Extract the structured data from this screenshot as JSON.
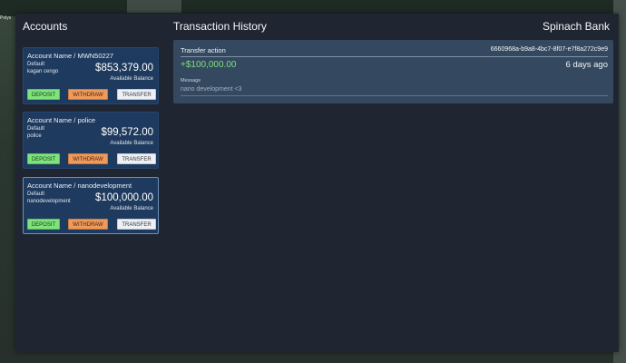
{
  "background": {
    "world_label": "Polys"
  },
  "header": {
    "accounts_title": "Accounts",
    "history_title": "Transaction History",
    "bank_name": "Spinach Bank"
  },
  "accounts": [
    {
      "name": "Account Name / MWN50227",
      "type": "Default",
      "owner": "kagan cengo",
      "balance": "$853,379.00",
      "balance_label": "Available Balance",
      "selected": false
    },
    {
      "name": "Account Name / police",
      "type": "Default",
      "owner": "police",
      "balance": "$99,572.00",
      "balance_label": "Available Balance",
      "selected": false
    },
    {
      "name": "Account Name / nanodevelopment",
      "type": "Default",
      "owner": "nanodevelopment",
      "balance": "$100,000.00",
      "balance_label": "Available Balance",
      "selected": true
    }
  ],
  "buttons": {
    "deposit": "DEPOSIT",
    "withdraw": "WITHDRAW",
    "transfer": "TRANSFER"
  },
  "transactions": [
    {
      "action": "Transfer action",
      "id": "6660968a-b9a8-4bc7-8f07-e7f8a272c9e9",
      "amount": "+$100,000.00",
      "time": "6 days ago",
      "message_label": "Message",
      "message": "nano development <3"
    }
  ],
  "colors": {
    "panel": "#1f2631",
    "account_card": "#1f3a5f",
    "transaction_card": "#34495f",
    "deposit": "#7de37a",
    "withdraw": "#ee9a5a",
    "transfer": "#eef0f3",
    "positive_amount": "#7ee07b"
  }
}
